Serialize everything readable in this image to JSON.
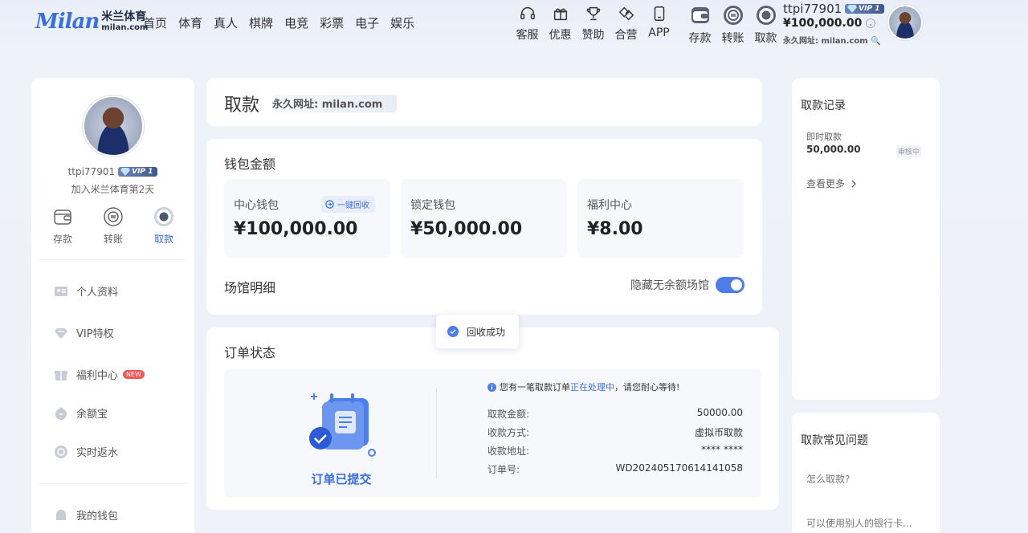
{
  "header": {
    "logo_mark": "Milan",
    "logo_cn": "米兰体育",
    "logo_en": "milan.com",
    "nav": [
      "首页",
      "体育",
      "真人",
      "棋牌",
      "电竞",
      "彩票",
      "电子",
      "娱乐"
    ],
    "icons": [
      {
        "label": "客服",
        "icon": "headset-icon"
      },
      {
        "label": "优惠",
        "icon": "gift-icon"
      },
      {
        "label": "赞助",
        "icon": "trophy-icon"
      },
      {
        "label": "合营",
        "icon": "handshake-icon"
      },
      {
        "label": "APP",
        "icon": "phone-icon"
      }
    ],
    "actions": [
      {
        "label": "存款",
        "icon": "wallet-icon"
      },
      {
        "label": "转账",
        "icon": "transfer-icon"
      },
      {
        "label": "取款",
        "icon": "withdraw-icon"
      }
    ],
    "username": "ttpi77901",
    "vip": "VIP 1",
    "balance": "¥100,000.00",
    "permanent_url": "永久网址: milan.com"
  },
  "sidebar": {
    "username": "ttpi77901",
    "vip": "VIP 1",
    "join_text": "加入米兰体育第2天",
    "actions": [
      {
        "label": "存款",
        "icon": "wallet-icon"
      },
      {
        "label": "转账",
        "icon": "transfer-icon"
      },
      {
        "label": "取款",
        "icon": "withdraw-icon"
      }
    ],
    "menu": [
      {
        "label": "个人资料",
        "icon": "id-card-icon"
      },
      {
        "label": "VIP特权",
        "icon": "diamond-icon"
      },
      {
        "label": "福利中心",
        "icon": "gift-box-icon",
        "badge": "NEW"
      },
      {
        "label": "余额宝",
        "icon": "piggy-coin-icon"
      },
      {
        "label": "实时返水",
        "icon": "cashback-icon"
      },
      {
        "label": "我的钱包",
        "icon": "purse-icon"
      }
    ]
  },
  "title": {
    "text": "取款",
    "url": "永久网址: milan.com"
  },
  "wallet": {
    "title": "钱包金额",
    "boxes": [
      {
        "label": "中心钱包",
        "value": "¥100,000.00"
      },
      {
        "label": "锁定钱包",
        "value": "¥50,000.00"
      },
      {
        "label": "福利中心",
        "value": "¥8.00"
      }
    ],
    "recall_label": "一键回收",
    "venue_title": "场馆明细",
    "hide_label": "隐藏无余额场馆"
  },
  "toast": {
    "text": "回收成功"
  },
  "order": {
    "title": "订单状态",
    "status": "订单已提交",
    "notice_pre": "您有一笔取款订单",
    "notice_hl": "正在处理中",
    "notice_post": "，请您耐心等待!",
    "rows": [
      {
        "k": "取款金额:",
        "v": "50000.00"
      },
      {
        "k": "收款方式:",
        "v": "虚拟币取款"
      },
      {
        "k": "收款地址:",
        "v": "**** ****"
      },
      {
        "k": "订单号:",
        "v": "WD202405170614141058"
      }
    ]
  },
  "records": {
    "title": "取款记录",
    "type": "即时取款",
    "amount": "50,000.00",
    "status": "审核中",
    "more": "查看更多"
  },
  "faq": {
    "title": "取款常见问题",
    "questions": [
      "怎么取款?",
      "可以使用别人的银行卡..."
    ]
  },
  "colors": {
    "accent": "#3a6fe0",
    "toggle": "#4d7ee8",
    "badge": "#f05454"
  }
}
